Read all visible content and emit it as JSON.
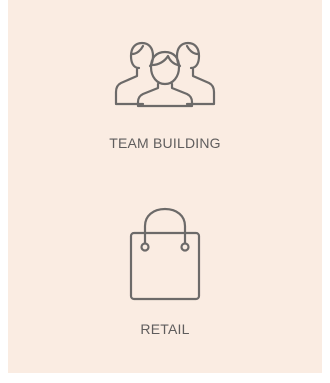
{
  "items": [
    {
      "label": "TEAM BUILDING",
      "icon": "team-people-icon"
    },
    {
      "label": "RETAIL",
      "icon": "shopping-bag-icon"
    }
  ],
  "colors": {
    "background": "#faece2",
    "icon_stroke": "#6c6a69",
    "text": "#5f5d5d"
  }
}
